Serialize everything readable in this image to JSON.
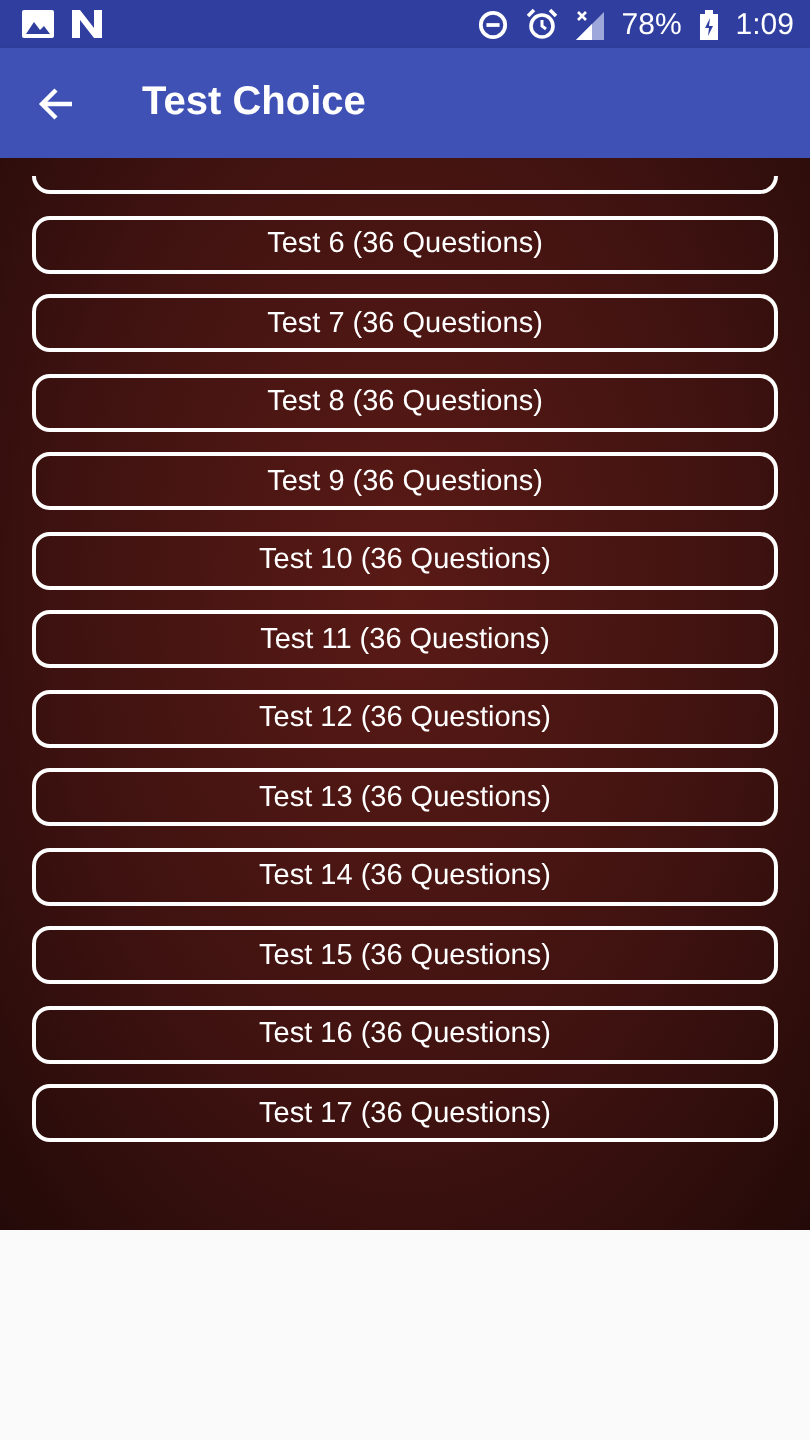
{
  "status_bar": {
    "battery": "78%",
    "time": "1:09"
  },
  "app_bar": {
    "title": "Test Choice"
  },
  "tests": [
    {
      "label": "Test 6 (36 Questions)"
    },
    {
      "label": "Test 7 (36 Questions)"
    },
    {
      "label": "Test 8 (36 Questions)"
    },
    {
      "label": "Test 9 (36 Questions)"
    },
    {
      "label": "Test 10 (36 Questions)"
    },
    {
      "label": "Test 11 (36 Questions)"
    },
    {
      "label": "Test 12 (36 Questions)"
    },
    {
      "label": "Test 13 (36 Questions)"
    },
    {
      "label": "Test 14 (36 Questions)"
    },
    {
      "label": "Test 15 (36 Questions)"
    },
    {
      "label": "Test 16 (36 Questions)"
    },
    {
      "label": "Test 17 (36 Questions)"
    }
  ]
}
